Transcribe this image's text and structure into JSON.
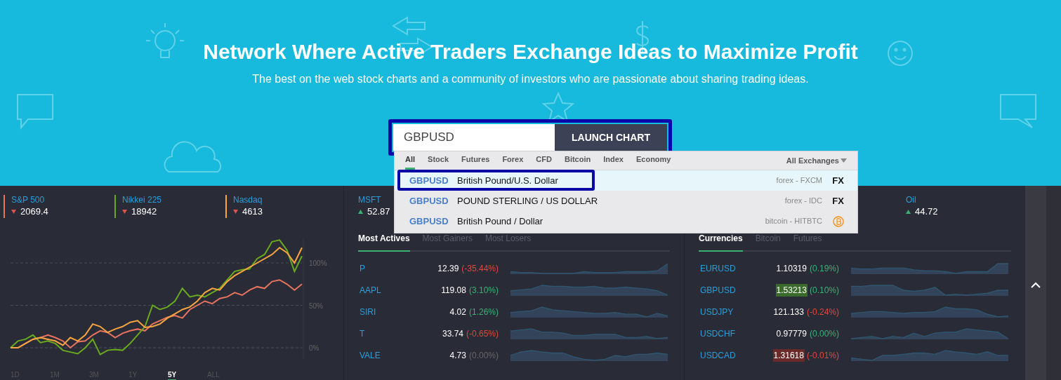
{
  "header": {
    "title": "Network Where Active Traders Exchange Ideas to Maximize Profit",
    "subtitle": "The best on the web stock charts and a community of investors who are passionate about sharing trading ideas.",
    "search": {
      "value": "GBPUSD"
    },
    "launch_button": "LAUNCH CHART"
  },
  "search_dropdown": {
    "tabs": [
      {
        "label": "All",
        "selected": true
      },
      {
        "label": "Stock",
        "selected": false
      },
      {
        "label": "Futures",
        "selected": false
      },
      {
        "label": "Forex",
        "selected": false
      },
      {
        "label": "CFD",
        "selected": false
      },
      {
        "label": "Bitcoin",
        "selected": false
      },
      {
        "label": "Index",
        "selected": false
      },
      {
        "label": "Economy",
        "selected": false
      }
    ],
    "exchange_filter": "All Exchanges",
    "results": [
      {
        "symbol": "GBPUSD",
        "description": "British Pound/U.S. Dollar",
        "source": "forex - FXCM",
        "kind": "fx",
        "badge": "FX",
        "selected": true
      },
      {
        "symbol": "GBPUSD",
        "description": "POUND STERLING / US DOLLAR",
        "source": "forex - IDC",
        "kind": "fx",
        "badge": "FX",
        "selected": false
      },
      {
        "symbol": "GBPUSD",
        "description": "British Pound / Dollar",
        "source": "bitcoin - HITBTC",
        "kind": "bitcoin",
        "selected": false
      }
    ]
  },
  "index_tickers": [
    {
      "value": "2069.4",
      "rising": false
    },
    {
      "value": "18942",
      "rising": false
    },
    {
      "value": "4613",
      "rising": false
    }
  ],
  "market_tickers": [
    {
      "name": "MSFT",
      "value": "52.87",
      "rising": true
    },
    {
      "name": "Oil",
      "value": "44.72",
      "rising": true
    }
  ],
  "chart_data": {
    "type": "line",
    "grid": true,
    "ylim": [
      -15,
      130
    ],
    "yticks": [
      {
        "value": 0,
        "label": "0%"
      },
      {
        "value": 50,
        "label": "50%"
      },
      {
        "value": 100,
        "label": "100%"
      }
    ],
    "series": [
      {
        "name": "S&P 500",
        "color": "#e8735f",
        "values": [
          0,
          0,
          5,
          10,
          12,
          15,
          12,
          8,
          0,
          7,
          8,
          15,
          20,
          18,
          12,
          17,
          20,
          22,
          20,
          28,
          32,
          36,
          38,
          35,
          45,
          50,
          55,
          52,
          58,
          60,
          65,
          62,
          68,
          72,
          70,
          78,
          80,
          75,
          68,
          75
        ]
      },
      {
        "name": "Nikkei 225",
        "color": "#6aaa1e",
        "values": [
          0,
          8,
          10,
          15,
          6,
          8,
          5,
          -3,
          -5,
          -7,
          0,
          10,
          -8,
          -3,
          -2,
          -3,
          5,
          15,
          25,
          50,
          45,
          48,
          55,
          70,
          60,
          62,
          60,
          65,
          70,
          80,
          90,
          92,
          93,
          105,
          110,
          125,
          127,
          115,
          90,
          108
        ]
      },
      {
        "name": "Nasdaq",
        "color": "#f7a541",
        "values": [
          0,
          0,
          5,
          10,
          12,
          10,
          8,
          3,
          12,
          8,
          15,
          28,
          25,
          18,
          22,
          25,
          30,
          32,
          24,
          25,
          28,
          35,
          40,
          45,
          48,
          55,
          65,
          70,
          68,
          78,
          85,
          90,
          95,
          100,
          105,
          110,
          118,
          112,
          100,
          118
        ]
      }
    ]
  },
  "range_buttons": [
    {
      "label": "1D",
      "selected": false
    },
    {
      "label": "1M",
      "selected": false
    },
    {
      "label": "3M",
      "selected": false
    },
    {
      "label": "1Y",
      "selected": false
    },
    {
      "label": "5Y",
      "selected": true
    },
    {
      "label": "ALL",
      "selected": false
    }
  ],
  "stocks_panel": {
    "tabs": [
      {
        "label": "Most Actives",
        "selected": true
      },
      {
        "label": "Most Gainers",
        "selected": false
      },
      {
        "label": "Most Losers",
        "selected": false
      }
    ],
    "rows": [
      {
        "symbol": "P",
        "price": "12.39",
        "change": "(-35.44%)",
        "color": "#e0493e"
      },
      {
        "symbol": "AAPL",
        "price": "119.08",
        "change": "(3.10%)",
        "color": "#3bb174"
      },
      {
        "symbol": "SIRI",
        "price": "4.02",
        "change": "(1.26%)",
        "color": "#3bb174"
      },
      {
        "symbol": "T",
        "price": "33.74",
        "change": "(-0.65%)",
        "color": "#e0493e"
      },
      {
        "symbol": "VALE",
        "price": "4.73",
        "change": "(0.00%)",
        "color": "#666666"
      }
    ]
  },
  "currencies_panel": {
    "tabs": [
      {
        "label": "Currencies",
        "selected": true
      },
      {
        "label": "Bitcoin",
        "selected": false
      },
      {
        "label": "Futures",
        "selected": false
      }
    ],
    "rows": [
      {
        "symbol": "EURUSD",
        "price": "1.10319",
        "change": "(0.19%)",
        "color": "#3bb174",
        "flashed": false
      },
      {
        "symbol": "GBPUSD",
        "price": "1.53213",
        "change": "(0.10%)",
        "color": "#3bb174",
        "flashed": true
      },
      {
        "symbol": "USDJPY",
        "price": "121.133",
        "change": "(-0.24%)",
        "color": "#e0493e",
        "flashed": false
      },
      {
        "symbol": "USDCHF",
        "price": "0.97779",
        "change": "(0.00%)",
        "color": "#3bb174",
        "flashed": false
      },
      {
        "symbol": "USDCAD",
        "price": "1.31618",
        "change": "(-0.01%)",
        "color": "#e0493e",
        "flashed": true
      }
    ]
  }
}
